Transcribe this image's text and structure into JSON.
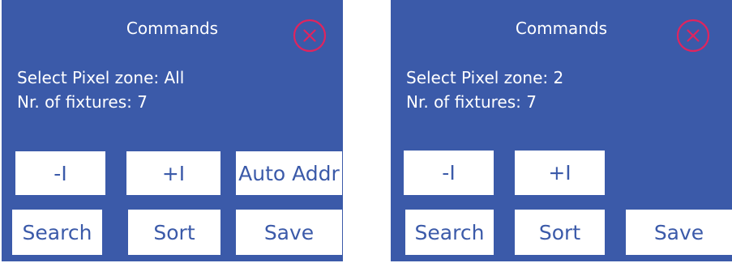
{
  "colors": {
    "panel_bg": "#3b5aa9",
    "button_bg": "#ffffff",
    "button_text": "#3b5aa9",
    "close_icon": "#e0245e",
    "text": "#ffffff"
  },
  "icons": {
    "close": "close-icon"
  },
  "panels": [
    {
      "title": "Commands",
      "zone_text": "Select Pixel zone: All",
      "fixtures_text": "Nr. of fixtures: 7",
      "buttons": {
        "minus": "-I",
        "plus": "+I",
        "auto_addr": "Auto Addr",
        "search": "Search",
        "sort": "Sort",
        "save": "Save"
      }
    },
    {
      "title": "Commands",
      "zone_text": "Select Pixel zone: 2",
      "fixtures_text": "Nr. of fixtures: 7",
      "buttons": {
        "minus": "-I",
        "plus": "+I",
        "search": "Search",
        "sort": "Sort",
        "save": "Save"
      }
    }
  ]
}
